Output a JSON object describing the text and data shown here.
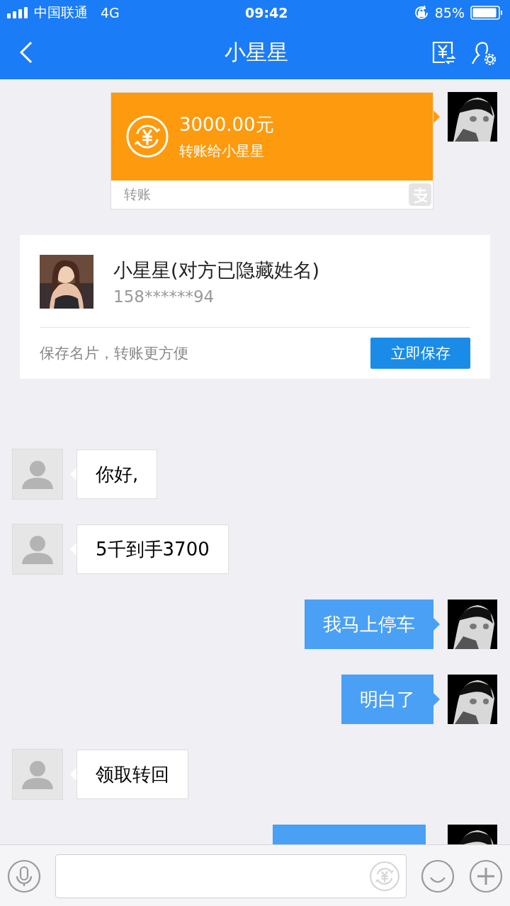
{
  "status_bar": {
    "carrier": "中国联通",
    "network": "4G",
    "time": "09:42",
    "battery": "85%"
  },
  "header": {
    "title": "小星星"
  },
  "messages": [
    {
      "kind": "transfer",
      "amount": "3000.00元",
      "note": "转账给小星星",
      "footer": "转账"
    },
    {
      "kind": "card",
      "name": "小星星(对方已隐藏姓名)",
      "phone": "158******94",
      "hint": "保存名片，转账更方便",
      "button": "立即保存"
    },
    {
      "kind": "incoming",
      "text": "你好,"
    },
    {
      "kind": "incoming",
      "text": "5千到手3700"
    },
    {
      "kind": "outgoing",
      "text": "我马上停车"
    },
    {
      "kind": "outgoing",
      "text": "明白了"
    },
    {
      "kind": "incoming",
      "text": "领取转回"
    },
    {
      "kind": "partial"
    }
  ]
}
